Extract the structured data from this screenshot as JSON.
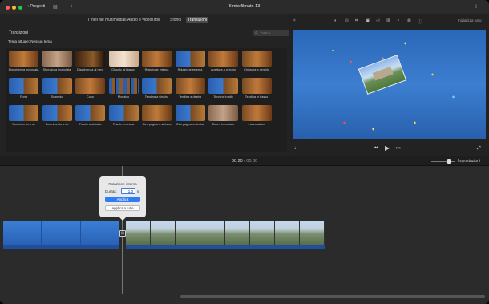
{
  "window": {
    "title": "Il mio filmato 13",
    "back_label": "Progetti",
    "traffic_lights": [
      "#ff5f57",
      "#febc2e",
      "#28c840"
    ]
  },
  "browser": {
    "tabs": [
      {
        "label": "I miei file multimediali",
        "active": false
      },
      {
        "label": "Audio e video",
        "active": false
      },
      {
        "label": "Titoli",
        "active": false
      },
      {
        "label": "Sfondi",
        "active": false
      },
      {
        "label": "Transizioni",
        "active": true
      }
    ],
    "section_title": "Transizioni",
    "search_placeholder": "Cerca",
    "theme_line": "Tema attuale: Nessun tema",
    "transitions": [
      {
        "label": "Dissolvenza incrociata",
        "style": "bears"
      },
      {
        "label": "Sfumatura incrociata",
        "style": "bears-soft"
      },
      {
        "label": "Dissolvenza al nero",
        "style": "bears-dark"
      },
      {
        "label": "Dissolv. al bianco",
        "style": "bears-light"
      },
      {
        "label": "Rotazione interna",
        "style": "bears"
      },
      {
        "label": "Rotazione esterna",
        "style": "split"
      },
      {
        "label": "Apertura a cerchio",
        "style": "bears"
      },
      {
        "label": "Chiusura a cerchio",
        "style": "bears"
      },
      {
        "label": "Porta",
        "style": "split"
      },
      {
        "label": "Scambio",
        "style": "split"
      },
      {
        "label": "Cubo",
        "style": "bears"
      },
      {
        "label": "Mosaico",
        "style": "mosaic"
      },
      {
        "label": "Tendina a sinistra",
        "style": "split"
      },
      {
        "label": "Tendina a destra",
        "style": "bears"
      },
      {
        "label": "Tendina in alto",
        "style": "split"
      },
      {
        "label": "Tendina in basso",
        "style": "bears"
      },
      {
        "label": "Scorrimento a sx",
        "style": "split"
      },
      {
        "label": "Scorrimento a dx",
        "style": "split"
      },
      {
        "label": "Puzzle a sinistra",
        "style": "split"
      },
      {
        "label": "Puzzle a destra",
        "style": "split"
      },
      {
        "label": "Giro pagina a sinistra",
        "style": "bears"
      },
      {
        "label": "Giro pagina a destra",
        "style": "split"
      },
      {
        "label": "Zoom incrociato",
        "style": "bears-soft"
      },
      {
        "label": "Increspatura",
        "style": "bears"
      }
    ]
  },
  "viewer": {
    "reset_label": "Inizializza tutto"
  },
  "timeline": {
    "current_time": "00:20",
    "separator": " / ",
    "total_time": "00:30",
    "settings_label": "Impostazioni",
    "transition_marker": "⊞"
  },
  "popover": {
    "title": "Rotazione interna",
    "duration_label": "Durata:",
    "duration_value": "1.0",
    "duration_unit": "s",
    "apply_label": "Applica",
    "apply_all_label": "Applica a tutte"
  }
}
